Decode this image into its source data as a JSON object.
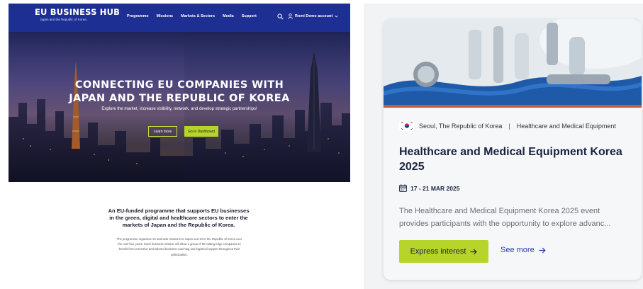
{
  "left": {
    "nav": {
      "logo_title": "EU BUSINESS HUB",
      "logo_sub": "Japan and the Republic of Korea",
      "menu": [
        "Programme",
        "Missions",
        "Markets & Sectors",
        "Media",
        "Support"
      ],
      "user_label": "Romi Demo account"
    },
    "hero": {
      "title_line1": "CONNECTING EU COMPANIES WITH",
      "title_line2": "JAPAN AND THE REPUBLIC OF KOREA",
      "subtitle": "Explore the market, increase visibility, network, and develop strategic partnerships!",
      "login_label": "Learn more",
      "dashboard_label": "Go to Dashboard"
    },
    "intro": {
      "title": "An EU-funded programme that supports EU businesses in the green, digital and healthcare sectors to enter the markets of Japan and the Republic of Korea.",
      "body": "The programme organises 10 business missions to Japan and 10 to the Republic of Korea over the next four years. Each business mission will allow a group of 50 cutting-edge companies to benefit from extensive and tailored business coaching and logistical support throughout their participation."
    }
  },
  "card": {
    "location": "Seoul, The Republic of Korea",
    "separator": "|",
    "sector": "Healthcare and Medical Equipment",
    "title": "Healthcare and Medical Equipment Korea 2025",
    "date": "17 - 21 MAR 2025",
    "description": "The Healthcare and Medical Equipment Korea 2025 event provides participants with the opportunity to explore advanc...",
    "express_label": "Express interest",
    "see_more_label": "See more"
  },
  "colors": {
    "nav_blue": "#1e2f93",
    "accent_green": "#b7d42b",
    "card_stripe": "#c8593a",
    "link_blue": "#2a3bb0"
  }
}
